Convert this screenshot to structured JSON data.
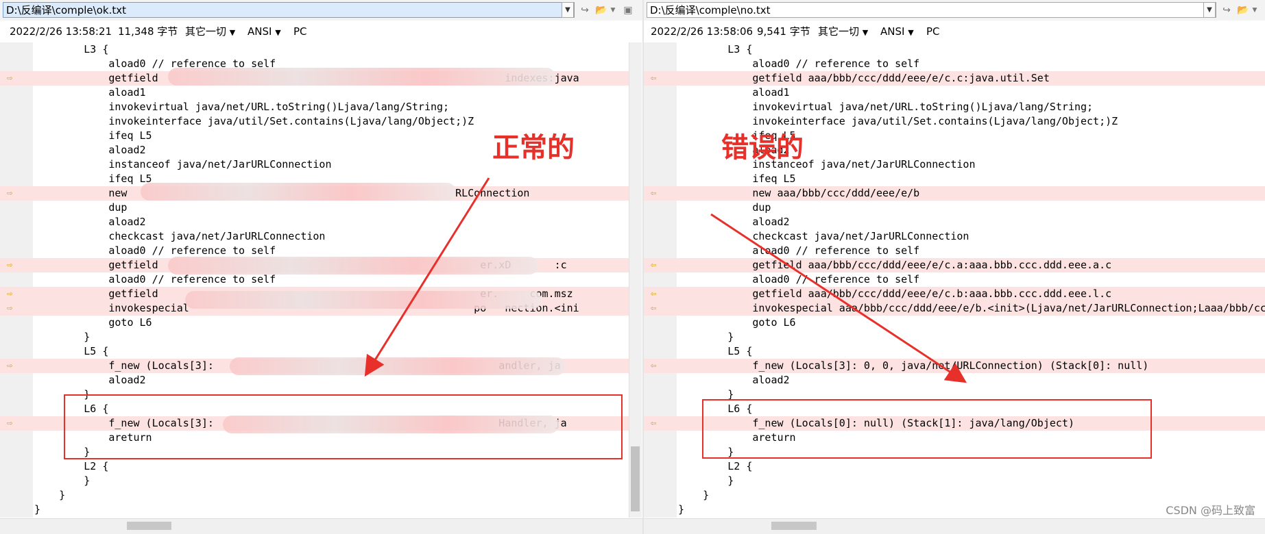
{
  "left": {
    "path": "D:\\反编译\\comple\\ok.txt",
    "datetime": "2022/2/26 13:58:21",
    "size": "11,348 字节",
    "encoding_other": "其它一切",
    "charset": "ANSI",
    "eol": "PC",
    "lines": [
      {
        "text": "        L3 {",
        "diff": false
      },
      {
        "text": "            aload0 // reference to self",
        "diff": false
      },
      {
        "text": "            getfield                                                        indexes:java",
        "diff": true
      },
      {
        "text": "            aload1",
        "diff": false
      },
      {
        "text": "            invokevirtual java/net/URL.toString()Ljava/lang/String;",
        "diff": false
      },
      {
        "text": "            invokeinterface java/util/Set.contains(Ljava/lang/Object;)Z",
        "diff": false
      },
      {
        "text": "            ifeq L5",
        "diff": false
      },
      {
        "text": "            aload2",
        "diff": false
      },
      {
        "text": "            instanceof java/net/JarURLConnection",
        "diff": false
      },
      {
        "text": "            ifeq L5",
        "diff": false
      },
      {
        "text": "            new                                                     RLConnection",
        "diff": true
      },
      {
        "text": "            dup",
        "diff": false
      },
      {
        "text": "            aload2",
        "diff": false
      },
      {
        "text": "            checkcast java/net/JarURLConnection",
        "diff": false
      },
      {
        "text": "            aload0 // reference to self",
        "diff": false
      },
      {
        "text": "            getfield                                                    er.xD       :c",
        "diff": true
      },
      {
        "text": "            aload0 // reference to self",
        "diff": false
      },
      {
        "text": "            getfield                                                    er.     com.msz",
        "diff": true
      },
      {
        "text": "            invokespecial                                              po   nection.<ini",
        "diff": true
      },
      {
        "text": "            goto L6",
        "diff": false
      },
      {
        "text": "        }",
        "diff": false
      },
      {
        "text": "        L5 {",
        "diff": false
      },
      {
        "text": "            f_new (Locals[3]:                                              andler, ja",
        "diff": true
      },
      {
        "text": "            aload2",
        "diff": false
      },
      {
        "text": "        }",
        "diff": false
      },
      {
        "text": "        L6 {",
        "diff": false
      },
      {
        "text": "            f_new (Locals[3]:                                              Handler, ja",
        "diff": true
      },
      {
        "text": "            areturn",
        "diff": false
      },
      {
        "text": "        }",
        "diff": false
      },
      {
        "text": "        L2 {",
        "diff": false
      },
      {
        "text": "        }",
        "diff": false
      },
      {
        "text": "    }",
        "diff": false
      },
      {
        "text": "}",
        "diff": false
      }
    ]
  },
  "right": {
    "path": "D:\\反编译\\comple\\no.txt",
    "datetime": "2022/2/26 13:58:06",
    "size": "9,541 字节",
    "encoding_other": "其它一切",
    "charset": "ANSI",
    "eol": "PC",
    "lines": [
      {
        "text": "        L3 {",
        "diff": false
      },
      {
        "text": "            aload0 // reference to self",
        "diff": false
      },
      {
        "text": "            getfield aaa/bbb/ccc/ddd/eee/e/c.c:java.util.Set",
        "diff": true
      },
      {
        "text": "            aload1",
        "diff": false
      },
      {
        "text": "            invokevirtual java/net/URL.toString()Ljava/lang/String;",
        "diff": false
      },
      {
        "text": "            invokeinterface java/util/Set.contains(Ljava/lang/Object;)Z",
        "diff": false
      },
      {
        "text": "            ifeq L5",
        "diff": false
      },
      {
        "text": "            aload2",
        "diff": false
      },
      {
        "text": "            instanceof java/net/JarURLConnection",
        "diff": false
      },
      {
        "text": "            ifeq L5",
        "diff": false
      },
      {
        "text": "            new aaa/bbb/ccc/ddd/eee/e/b",
        "diff": true
      },
      {
        "text": "            dup",
        "diff": false
      },
      {
        "text": "            aload2",
        "diff": false
      },
      {
        "text": "            checkcast java/net/JarURLConnection",
        "diff": false
      },
      {
        "text": "            aload0 // reference to self",
        "diff": false
      },
      {
        "text": "            getfield aaa/bbb/ccc/ddd/eee/e/c.a:aaa.bbb.ccc.ddd.eee.a.c",
        "diff": true
      },
      {
        "text": "            aload0 // reference to self",
        "diff": false
      },
      {
        "text": "            getfield aaa/bbb/ccc/ddd/eee/e/c.b:aaa.bbb.ccc.ddd.eee.l.c",
        "diff": true
      },
      {
        "text": "            invokespecial aaa/bbb/ccc/ddd/eee/e/b.<init>(Ljava/net/JarURLConnection;Laaa/bbb/cc",
        "diff": true
      },
      {
        "text": "            goto L6",
        "diff": false
      },
      {
        "text": "        }",
        "diff": false
      },
      {
        "text": "        L5 {",
        "diff": false
      },
      {
        "text": "            f_new (Locals[3]: 0, 0, java/net/URLConnection) (Stack[0]: null)",
        "diff": true
      },
      {
        "text": "            aload2",
        "diff": false
      },
      {
        "text": "        }",
        "diff": false
      },
      {
        "text": "        L6 {",
        "diff": false
      },
      {
        "text": "            f_new (Locals[0]: null) (Stack[1]: java/lang/Object)",
        "diff": true
      },
      {
        "text": "            areturn",
        "diff": false
      },
      {
        "text": "        }",
        "diff": false
      },
      {
        "text": "        L2 {",
        "diff": false
      },
      {
        "text": "        }",
        "diff": false
      },
      {
        "text": "    }",
        "diff": false
      },
      {
        "text": "}",
        "diff": false
      }
    ]
  },
  "annotations": {
    "left_label": "正常的",
    "right_label": "错误的"
  },
  "watermark": "CSDN @码上致富",
  "colors": {
    "accent_red": "#e8302a",
    "diff_bg": "#fde2e2",
    "marker": "#d4a300"
  }
}
